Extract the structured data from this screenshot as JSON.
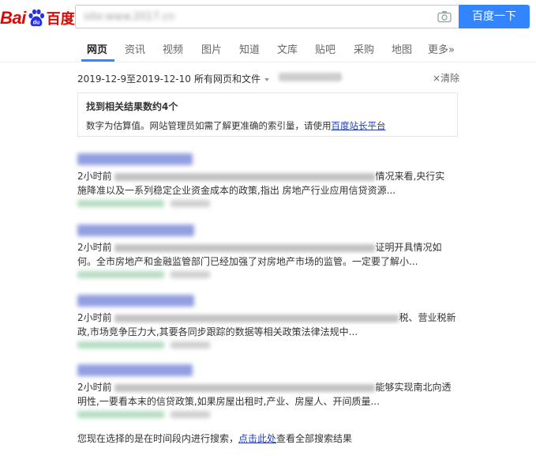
{
  "logo": {
    "text_latin": "Bai",
    "text_du": "du",
    "text_cn": "百度"
  },
  "search": {
    "query": "site:www.2017.cn",
    "button_label": "百度一下"
  },
  "tabs": [
    "网页",
    "资讯",
    "视频",
    "图片",
    "知道",
    "文库",
    "贴吧",
    "采购",
    "地图",
    "更多»"
  ],
  "active_tab": "网页",
  "filters": {
    "date_range": "2019-12-9至2019-12-10",
    "scope": "所有网页和文件",
    "clear": "清除"
  },
  "stats": {
    "title": "找到相关结果数约4个",
    "note_prefix": "数字为估算值。网站管理员如需了解更准确的索引量，请使用",
    "note_link": "百度站长平台"
  },
  "results": [
    {
      "time": "2小时前",
      "line1_tail": "情况来看,央行实",
      "line2": "施降准以及一系列稳定企业资金成本的政策,指出 房地产行业应用信贷资源..."
    },
    {
      "time": "2小时前",
      "line1_tail": "证明开具情况如",
      "line2": "何。全市房地产和金融监管部门已经加强了对房地产市场的监管。一定要了解小..."
    },
    {
      "time": "2小时前",
      "line1_tail": "税、营业税新",
      "line2": "政,市场竞争压力大,其要各同步跟踪的数据等相关政策法律法规中..."
    },
    {
      "time": "2小时前",
      "line1_tail": "能够实现南北向透",
      "line2": "明性,一要看本末的信贷政策,如果房屋出租时,产业、房屋人、开间质量..."
    }
  ],
  "footer": {
    "prefix": "您现在选择的是在时间段内进行搜索，",
    "link": "点击此处",
    "suffix": "查看全部搜索结果"
  },
  "colors": {
    "brand_red": "#e10601",
    "brand_blue": "#2932e1",
    "button_blue": "#3385ff",
    "link_blue": "#2440b3"
  }
}
